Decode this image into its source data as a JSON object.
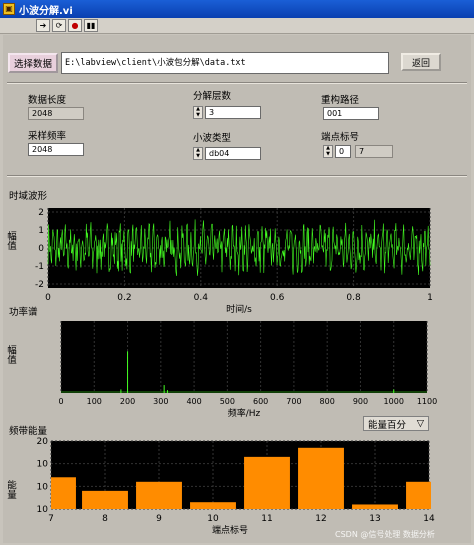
{
  "window": {
    "title": "小波分解.vi"
  },
  "controls": {
    "select_button": "选择数据",
    "file_path": "E:\\labview\\client\\小波包分解\\data.txt",
    "back_button": "返回"
  },
  "params": {
    "data_length_label": "数据长度",
    "data_length_value": "2048",
    "sample_rate_label": "采样频率",
    "sample_rate_value": "2048",
    "decomp_level_label": "分解层数",
    "decomp_level_value": "3",
    "wavelet_type_label": "小波类型",
    "wavelet_type_value": "db04",
    "recon_path_label": "重构路径",
    "recon_path_value": "001",
    "endpoint_label": "端点标号",
    "endpoint_index": "0",
    "endpoint_value": "7"
  },
  "waveform": {
    "title": "时域波形",
    "ylabel": "幅值",
    "xlabel": "时间/s",
    "yticks": [
      "2",
      "1",
      "0",
      "-1",
      "-2"
    ],
    "xticks": [
      "0",
      "0.2",
      "0.4",
      "0.6",
      "0.8",
      "1"
    ],
    "line_color": "#44ff22"
  },
  "spectrum": {
    "title": "功率谱",
    "ylabel": "幅值",
    "xlabel": "频率/Hz",
    "xticks": [
      "0",
      "100",
      "200",
      "300",
      "400",
      "500",
      "600",
      "700",
      "800",
      "900",
      "1000",
      "1100"
    ],
    "peaks": [
      {
        "freq": 200,
        "level": 0.58
      },
      {
        "freq": 180,
        "level": 0.05
      },
      {
        "freq": 310,
        "level": 0.11
      },
      {
        "freq": 320,
        "level": 0.04
      },
      {
        "freq": 1000,
        "level": 0.05
      }
    ]
  },
  "energy": {
    "title": "频带能量",
    "dropdown": "能量百分",
    "ylabel": "能量",
    "xlabel": "端点标号",
    "bar_color": "#ff8c00",
    "chart_data": {
      "type": "bar",
      "x": [
        7,
        8,
        9,
        10,
        11,
        12,
        13,
        14
      ],
      "values": [
        14,
        8,
        12,
        3,
        23,
        27,
        2,
        12
      ],
      "xlabel": "端点标号",
      "ylabel": "能量",
      "ylim": [
        0,
        30
      ],
      "yticks": [
        "20",
        "10",
        "10",
        "10"
      ],
      "xticks": [
        "7",
        "8",
        "9",
        "10",
        "11",
        "12",
        "13",
        "14"
      ]
    }
  },
  "watermark": "CSDN @信号处理 数据分析"
}
